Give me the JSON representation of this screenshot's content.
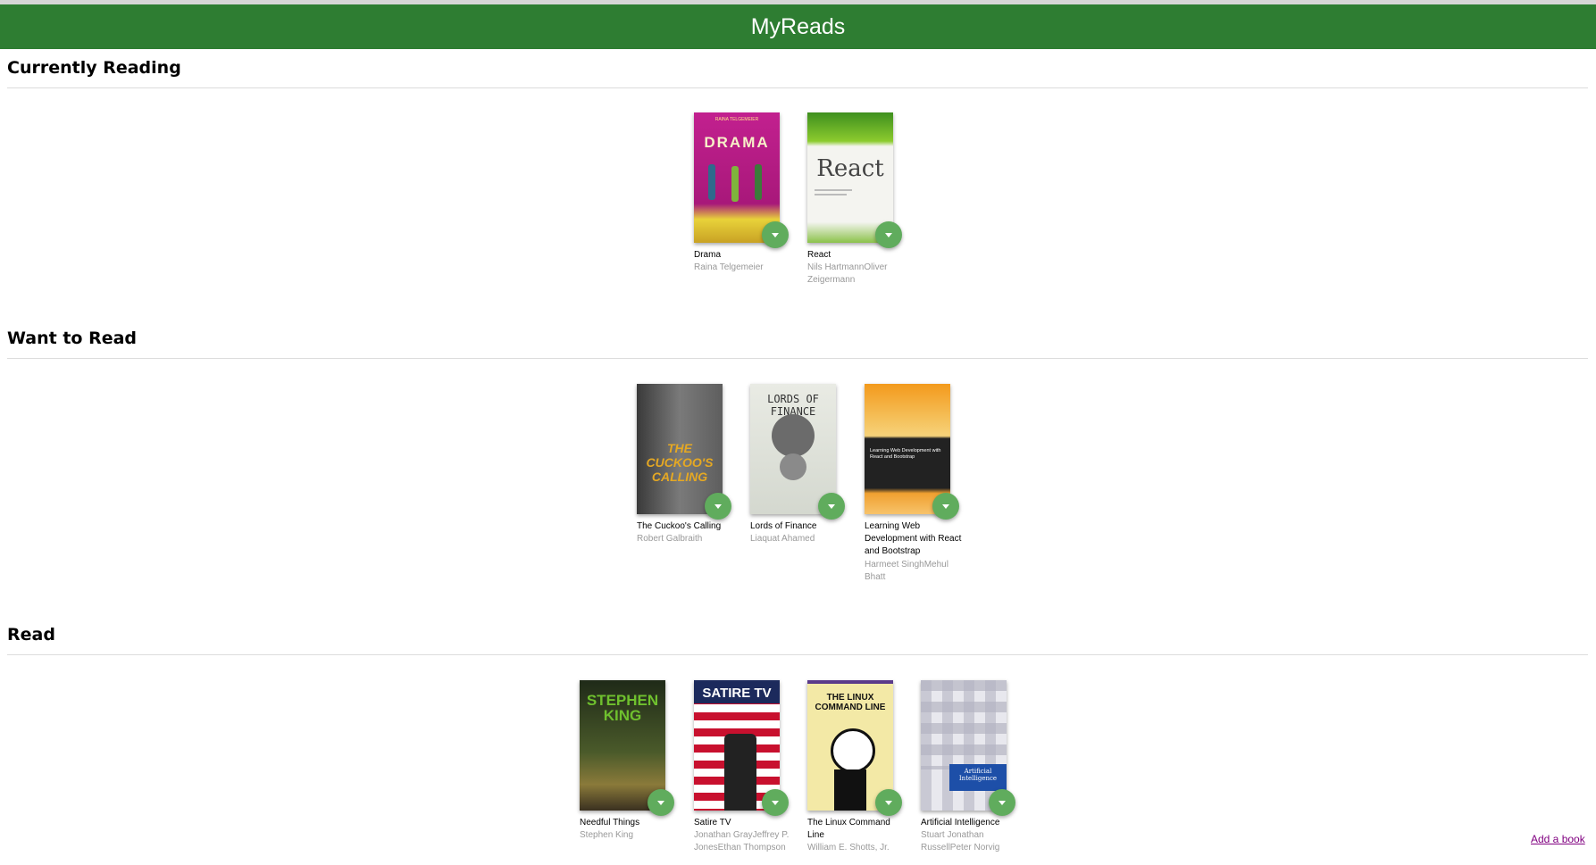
{
  "app": {
    "title": "MyReads"
  },
  "shelves": [
    {
      "title": "Currently Reading",
      "books": [
        {
          "title": "Drama",
          "authors": "Raina Telgemeier",
          "cover_text": "DRAMA",
          "cover_author": "RAINA TELGEMEIER"
        },
        {
          "title": "React",
          "authors": "Nils HartmannOliver Zeigermann",
          "cover_text": "React"
        }
      ]
    },
    {
      "title": "Want to Read",
      "books": [
        {
          "title": "The Cuckoo's Calling",
          "authors": "Robert Galbraith",
          "cover_text": "THE CUCKOO'S CALLING"
        },
        {
          "title": "Lords of Finance",
          "authors": "Liaquat Ahamed",
          "cover_text": "LORDS OF FINANCE"
        },
        {
          "title": "Learning Web Development with React and Bootstrap",
          "authors": "Harmeet SinghMehul Bhatt",
          "cover_text": "Learning Web Development with React and Bootstrap"
        }
      ]
    },
    {
      "title": "Read",
      "books": [
        {
          "title": "Needful Things",
          "authors": "Stephen King",
          "cover_text": "STEPHEN KING"
        },
        {
          "title": "Satire TV",
          "authors": "Jonathan GrayJeffrey P. JonesEthan Thompson",
          "cover_text": "SATIRE TV"
        },
        {
          "title": "The Linux Command Line",
          "authors": "William E. Shotts, Jr.",
          "cover_text": "THE LINUX COMMAND LINE"
        },
        {
          "title": "Artificial Intelligence",
          "authors": "Stuart Jonathan RussellPeter Norvig",
          "cover_text": "Artificial Intelligence"
        }
      ]
    }
  ],
  "footer": {
    "add_book_label": "Add a book"
  },
  "colors": {
    "appbar": "#2e7d32",
    "shelf_changer": "#60ac5d",
    "author_text": "#999999",
    "link": "#800080"
  }
}
